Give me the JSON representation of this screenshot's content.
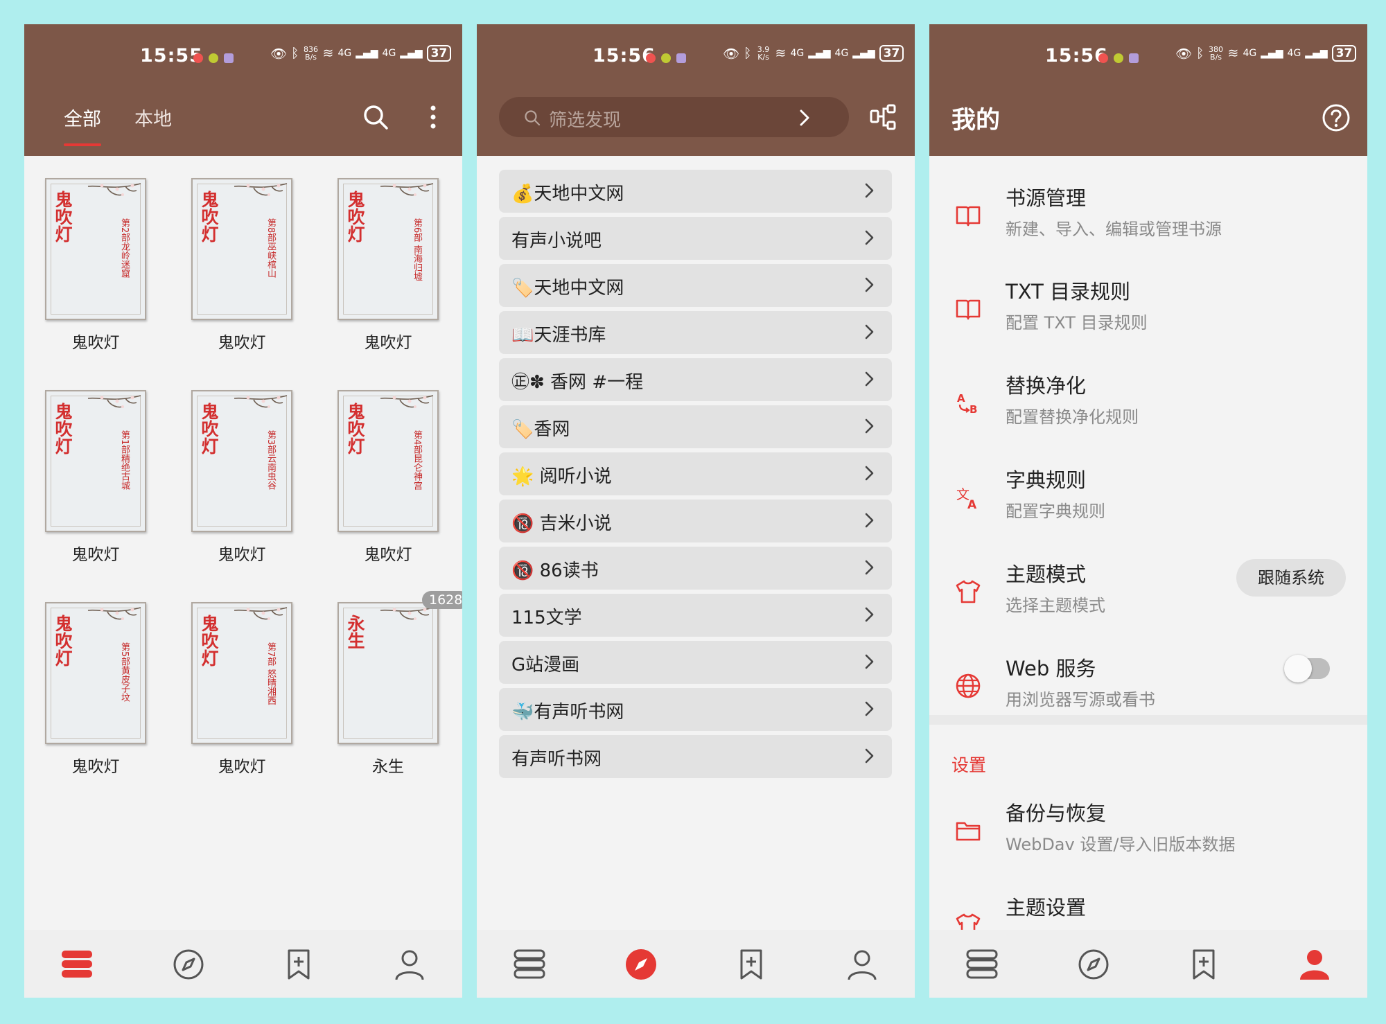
{
  "colors": {
    "header": "#7d5748",
    "accent": "#e53935",
    "background": "#f3f3f3",
    "page_bg": "#afeeee"
  },
  "status_bars": [
    {
      "time": "15:55",
      "speed": "836\nB/s",
      "battery": "37"
    },
    {
      "time": "15:56",
      "speed": "3.9\nK/s",
      "battery": "37"
    },
    {
      "time": "15:56",
      "speed": "380\nB/s",
      "battery": "37"
    }
  ],
  "status_signal": "4G",
  "shelf": {
    "tabs": [
      "全部",
      "本地"
    ],
    "books": [
      {
        "title": "鬼吹灯",
        "cover_title": "鬼吹灯",
        "cover_sub": "第2部龙岭迷窟"
      },
      {
        "title": "鬼吹灯",
        "cover_title": "鬼吹灯",
        "cover_sub": "第8部巫峡棺山"
      },
      {
        "title": "鬼吹灯",
        "cover_title": "鬼吹灯",
        "cover_sub": "第6部 南海归墟"
      },
      {
        "title": "鬼吹灯",
        "cover_title": "鬼吹灯",
        "cover_sub": "第1部精绝古城"
      },
      {
        "title": "鬼吹灯",
        "cover_title": "鬼吹灯",
        "cover_sub": "第3部云南虫谷"
      },
      {
        "title": "鬼吹灯",
        "cover_title": "鬼吹灯",
        "cover_sub": "第4部昆仑神宫"
      },
      {
        "title": "鬼吹灯",
        "cover_title": "鬼吹灯",
        "cover_sub": "第5部黄皮子坟"
      },
      {
        "title": "鬼吹灯",
        "cover_title": "鬼吹灯",
        "cover_sub": "第7部 怒晴湘西"
      },
      {
        "title": "永生",
        "cover_title": "永生",
        "cover_sub": "",
        "badge": "1628"
      }
    ]
  },
  "discover": {
    "search_placeholder": "筛选发现",
    "sources": [
      "💰天地中文网",
      "有声小说吧",
      "🏷️天地中文网",
      "📖天涯书库",
      "㊣✽ 香网 #一程",
      "🏷️香网",
      "🌟 阅听小说",
      "🔞 吉米小说",
      "🔞 86读书",
      "115文学",
      "G站漫画",
      "🐳有声听书网",
      "有声听书网"
    ]
  },
  "my": {
    "title": "我的",
    "items": [
      {
        "title": "书源管理",
        "subtitle": "新建、导入、编辑或管理书源"
      },
      {
        "title": "TXT 目录规则",
        "subtitle": "配置 TXT 目录规则"
      },
      {
        "title": "替换净化",
        "subtitle": "配置替换净化规则"
      },
      {
        "title": "字典规则",
        "subtitle": "配置字典规则"
      },
      {
        "title": "主题模式",
        "subtitle": "选择主题模式"
      },
      {
        "title": "Web 服务",
        "subtitle": "用浏览器写源或看书"
      }
    ],
    "theme_value": "跟随系统",
    "web_service_on": false,
    "section": "设置",
    "settings": [
      {
        "title": "备份与恢复",
        "subtitle": "WebDav 设置/导入旧版本数据"
      },
      {
        "title": "主题设置",
        "subtitle": ""
      }
    ]
  },
  "bottom_nav": [
    "bookshelf-icon",
    "compass-icon",
    "bookmark-add-icon",
    "person-icon"
  ]
}
